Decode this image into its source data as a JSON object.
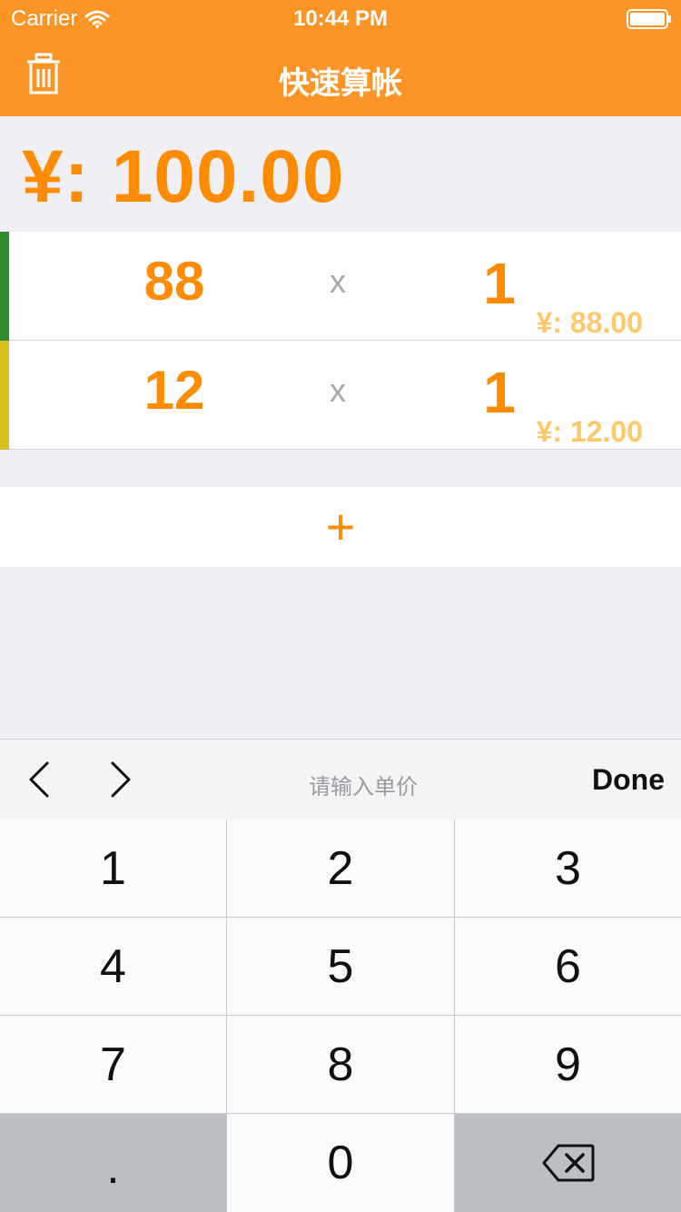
{
  "status_bar": {
    "carrier": "Carrier",
    "time": "10:44 PM"
  },
  "nav": {
    "title": "快速算帐"
  },
  "total": {
    "text": "¥: 100.00"
  },
  "items": [
    {
      "price": "88",
      "times": "x",
      "qty": "1",
      "subtotal": "¥: 88.00",
      "bar_color": "#2e8b2e"
    },
    {
      "price": "12",
      "times": "x",
      "qty": "1",
      "subtotal": "¥: 12.00",
      "bar_color": "#d6c21e"
    }
  ],
  "add_button": {
    "label": "+"
  },
  "keyboard_toolbar": {
    "hint": "请输入单价",
    "done_label": "Done"
  },
  "numpad": {
    "keys": [
      "1",
      "2",
      "3",
      "4",
      "5",
      "6",
      "7",
      "8",
      "9",
      ".",
      "0"
    ]
  },
  "colors": {
    "accent": "#fd9426",
    "value_orange": "#ff8c00",
    "subtotal": "#ffc86b"
  },
  "icons": [
    "wifi-icon",
    "battery-icon",
    "trash-icon",
    "chevron-left-icon",
    "chevron-right-icon",
    "backspace-icon"
  ]
}
